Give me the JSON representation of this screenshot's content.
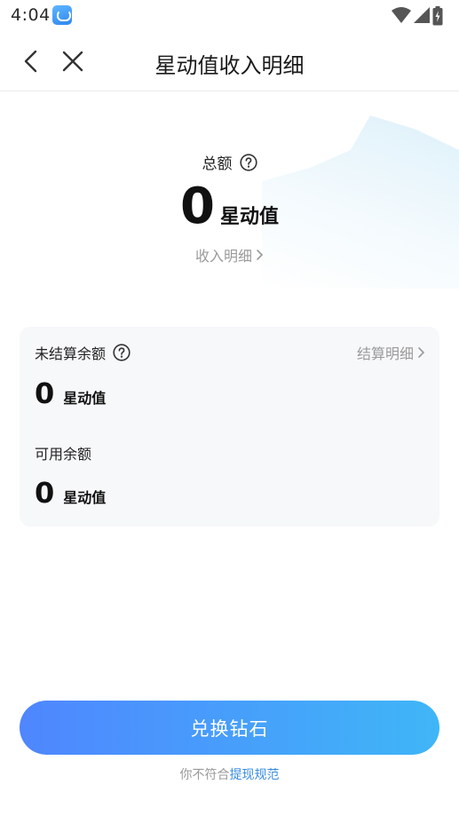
{
  "status_bar": {
    "time": "4:04"
  },
  "header": {
    "title": "星动值收入明细"
  },
  "total": {
    "label": "总额",
    "value": "0",
    "unit": "星动值",
    "income_link": "收入明细"
  },
  "card": {
    "unsettled_label": "未结算余额",
    "settle_link": "结算明细",
    "unsettled_value": "0",
    "unsettled_unit": "星动值",
    "available_label": "可用余额",
    "available_value": "0",
    "available_unit": "星动值"
  },
  "bottom": {
    "exchange_label": "兑换钻石",
    "policy_prefix": "你不符合",
    "policy_link": "提现规范"
  },
  "colors": {
    "accent_start": "#4f86ff",
    "accent_end": "#3fb6f7",
    "link": "#3a8de0",
    "muted": "#9a9a9a"
  },
  "icons": [
    "app-notification-icon",
    "wifi-icon",
    "signal-icon",
    "battery-icon",
    "back-icon",
    "close-icon",
    "help-icon",
    "chevron-right-icon"
  ]
}
